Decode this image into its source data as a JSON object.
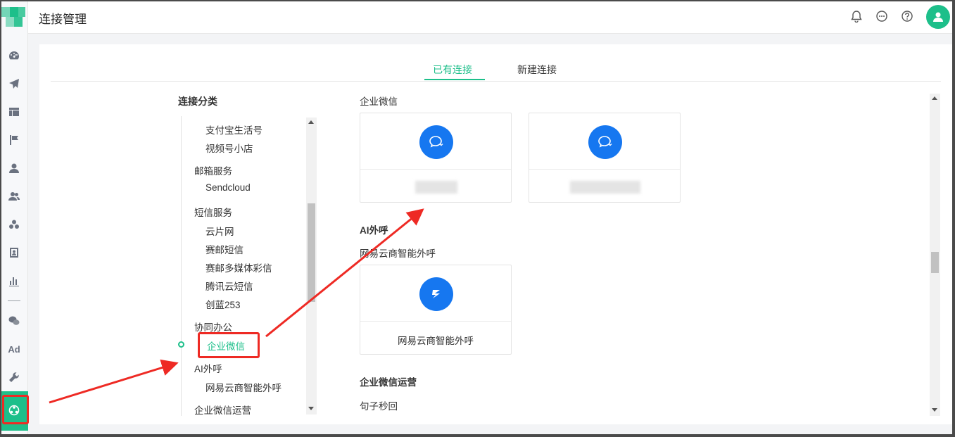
{
  "header": {
    "title": "连接管理"
  },
  "tabs": [
    {
      "label": "已有连接"
    },
    {
      "label": "新建连接"
    }
  ],
  "categories": {
    "title": "连接分类",
    "items": [
      {
        "label": "支付宝生活号",
        "level": "sub"
      },
      {
        "label": "视频号小店",
        "level": "sub"
      },
      {
        "label": "邮箱服务",
        "level": "group"
      },
      {
        "label": "Sendcloud",
        "level": "sub"
      },
      {
        "label": "短信服务",
        "level": "group"
      },
      {
        "label": "云片网",
        "level": "sub"
      },
      {
        "label": "赛邮短信",
        "level": "sub"
      },
      {
        "label": "赛邮多媒体彩信",
        "level": "sub"
      },
      {
        "label": "腾讯云短信",
        "level": "sub"
      },
      {
        "label": "创蓝253",
        "level": "sub"
      },
      {
        "label": "协同办公",
        "level": "group"
      },
      {
        "label": "企业微信",
        "level": "sub",
        "active": true
      },
      {
        "label": "AI外呼",
        "level": "group"
      },
      {
        "label": "网易云商智能外呼",
        "level": "sub"
      },
      {
        "label": "企业微信运营",
        "level": "group"
      }
    ]
  },
  "sections": {
    "wecom": {
      "title": "企业微信",
      "icon": "wecom-chat-icon"
    },
    "ai_call": {
      "title": "AI外呼",
      "subtitle": "网易云商智能外呼",
      "card_name": "网易云商智能外呼",
      "icon": "netease-call-icon"
    },
    "wecom_ops": {
      "title": "企业微信运营",
      "subtitle": "句子秒回"
    }
  },
  "sidebar": {
    "icons": [
      "dashboard-icon",
      "send-icon",
      "layout-icon",
      "flag-icon",
      "user-icon",
      "users-icon",
      "cluster-icon",
      "contact-book-icon",
      "bar-chart-icon",
      "wechat-icon",
      "ad-icon",
      "wrench-icon",
      "connection-hub-icon"
    ],
    "ad_label": "Ad"
  },
  "colors": {
    "accent": "#1dbf8a",
    "icon_blue": "#1677f0",
    "annotation_red": "#ee2a24"
  }
}
